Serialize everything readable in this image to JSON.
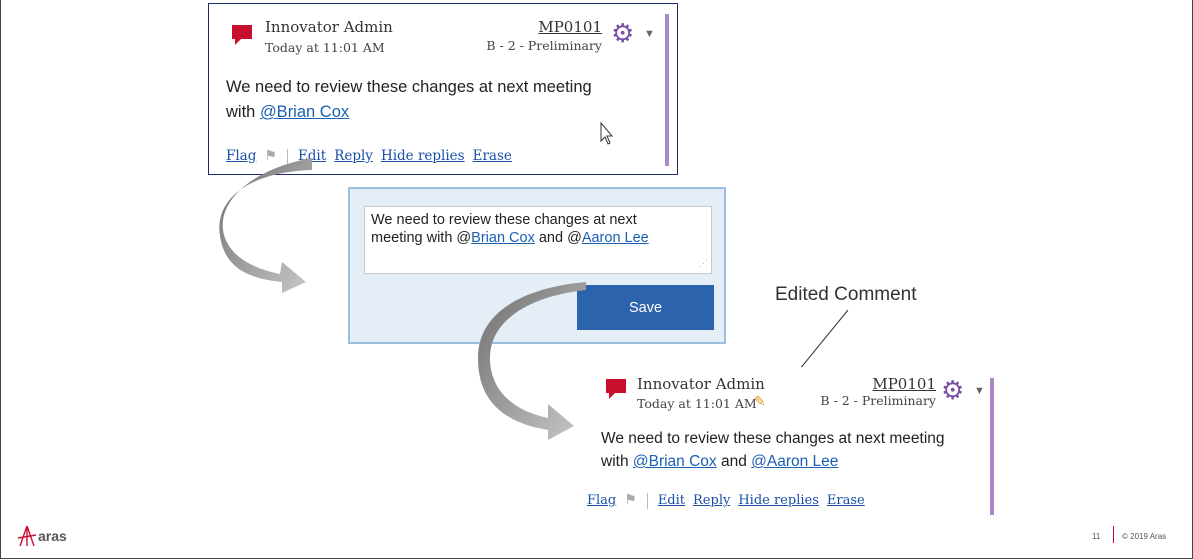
{
  "original_comment": {
    "author": "Innovator Admin",
    "timestamp": "Today at 11:01 AM",
    "item_number": "MP0101",
    "item_state": "B - 2 - Preliminary",
    "body_prefix": "We need to review these changes at next meeting",
    "body_with": "with ",
    "mention": "@Brian Cox",
    "actions": {
      "flag": "Flag",
      "edit": "Edit",
      "reply": "Reply",
      "hide_replies": "Hide replies",
      "erase": "Erase"
    }
  },
  "edit_panel": {
    "line1": "We need to review these changes at next",
    "line2_prefix": "meeting with @",
    "mention1": "Brian Cox",
    "and": " and @",
    "mention2": "Aaron Lee",
    "save_label": "Save"
  },
  "callout": {
    "label": "Edited Comment"
  },
  "edited_comment": {
    "author": "Innovator Admin",
    "timestamp": "Today at 11:01 AM",
    "item_number": "MP0101",
    "item_state": "B - 2 - Preliminary",
    "body_prefix": "We need to review these changes at next meeting",
    "body_with": "with ",
    "mention1": "@Brian Cox",
    "and": " and ",
    "mention2": "@Aaron Lee",
    "actions": {
      "flag": "Flag",
      "edit": "Edit",
      "reply": "Reply",
      "hide_replies": "Hide replies",
      "erase": "Erase"
    }
  },
  "footer": {
    "logo": "aras",
    "page_number": "11",
    "copyright": "© 2019 Aras"
  },
  "colors": {
    "accent": "#a888c6",
    "save_button": "#2c63ad",
    "author_icon": "#c8102e",
    "link": "#1a4fa8"
  },
  "icons": [
    "author-chat-icon",
    "gear-icon",
    "chevron-down-icon",
    "flag-icon",
    "pencil-icon",
    "cursor-icon",
    "aras-logo"
  ]
}
